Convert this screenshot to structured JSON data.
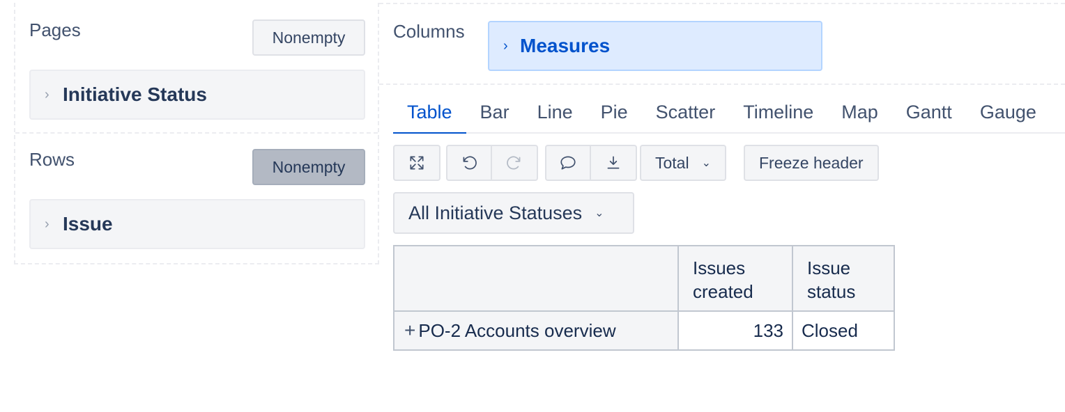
{
  "pages": {
    "title": "Pages",
    "nonempty_label": "Nonempty",
    "dimension": "Initiative Status"
  },
  "rows": {
    "title": "Rows",
    "nonempty_label": "Nonempty",
    "dimension": "Issue"
  },
  "columns": {
    "title": "Columns",
    "dimension": "Measures"
  },
  "tabs": [
    {
      "label": "Table",
      "active": true
    },
    {
      "label": "Bar"
    },
    {
      "label": "Line"
    },
    {
      "label": "Pie"
    },
    {
      "label": "Scatter"
    },
    {
      "label": "Timeline"
    },
    {
      "label": "Map"
    },
    {
      "label": "Gantt"
    },
    {
      "label": "Gauge"
    }
  ],
  "toolbar": {
    "icons": [
      "fullscreen-icon",
      "undo-icon",
      "redo-icon",
      "comment-icon",
      "export-icon"
    ],
    "total_label": "Total",
    "freeze_label": "Freeze header"
  },
  "filter": {
    "value": "All Initiative Statuses"
  },
  "table": {
    "headers": [
      "Issues created",
      "Issue status"
    ],
    "header_lines": [
      [
        "Issues",
        "created"
      ],
      [
        "Issue",
        "status"
      ]
    ],
    "rows": [
      {
        "label": "PO-2 Accounts overview",
        "issues_created": "133",
        "issue_status": "Closed"
      }
    ]
  },
  "colors": {
    "accent": "#0052cc",
    "measures_bg": "#deebff",
    "nonempty_active_bg": "#b3b9c4"
  }
}
